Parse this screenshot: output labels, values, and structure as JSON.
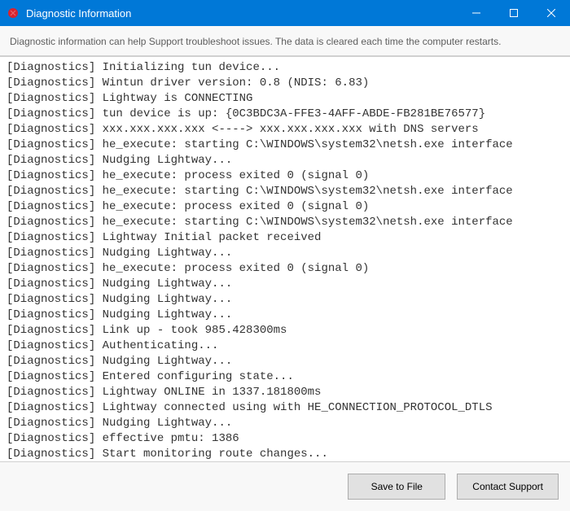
{
  "titlebar": {
    "title": "Diagnostic Information"
  },
  "description": "Diagnostic information can help Support troubleshoot issues. The data is cleared each time the computer restarts.",
  "log": {
    "prefix": "[Diagnostics]",
    "lines": [
      "Initializing tun device...",
      "Wintun driver version: 0.8 (NDIS: 6.83)",
      "Lightway is CONNECTING",
      "tun device is up: {0C3BDC3A-FFE3-4AFF-ABDE-FB281BE76577}",
      "xxx.xxx.xxx.xxx <----> xxx.xxx.xxx.xxx with DNS servers",
      "he_execute: starting C:\\WINDOWS\\system32\\netsh.exe interface",
      "Nudging Lightway...",
      "he_execute: process exited 0 (signal 0)",
      "he_execute: starting C:\\WINDOWS\\system32\\netsh.exe interface",
      "he_execute: process exited 0 (signal 0)",
      "he_execute: starting C:\\WINDOWS\\system32\\netsh.exe interface",
      "Lightway Initial packet received",
      "Nudging Lightway...",
      "he_execute: process exited 0 (signal 0)",
      "Nudging Lightway...",
      "Nudging Lightway...",
      "Nudging Lightway...",
      "Link up - took 985.428300ms",
      "Authenticating...",
      "Nudging Lightway...",
      "Entered configuring state...",
      "Lightway ONLINE in 1337.181800ms",
      "Lightway connected using with HE_CONNECTION_PROTOCOL_DTLS",
      "Nudging Lightway...",
      "effective pmtu: 1386",
      "Start monitoring route changes..."
    ]
  },
  "footer": {
    "save_label": "Save to File",
    "contact_label": "Contact Support"
  }
}
